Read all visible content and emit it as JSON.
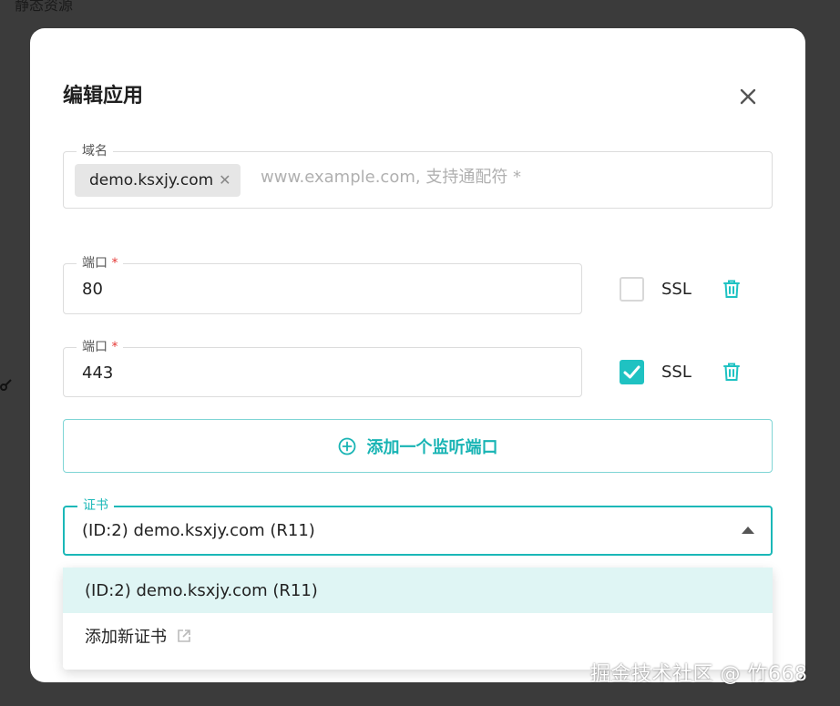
{
  "backdrop": {
    "text": "静态资源"
  },
  "dialog": {
    "title": "编辑应用"
  },
  "domain": {
    "label": "域名",
    "chip": "demo.ksxjy.com",
    "placeholder": "www.example.com, 支持通配符 *"
  },
  "ports": [
    {
      "label": "端口",
      "required": "*",
      "value": "80",
      "ssl_label": "SSL",
      "ssl_checked": false
    },
    {
      "label": "端口",
      "required": "*",
      "value": "443",
      "ssl_label": "SSL",
      "ssl_checked": true
    }
  ],
  "add_port": {
    "label": "添加一个监听端口"
  },
  "certificate": {
    "label": "证书",
    "value": "(ID:2) demo.ksxjy.com (R11)",
    "options": [
      {
        "label": "(ID:2) demo.ksxjy.com (R11)",
        "selected": true
      },
      {
        "label": "添加新证书",
        "selected": false
      }
    ]
  },
  "watermark": "掘金技术社区 @ 竹668",
  "colors": {
    "accent": "#1fc2c2",
    "selected_bg": "#dff5f4",
    "required": "#e53935"
  }
}
